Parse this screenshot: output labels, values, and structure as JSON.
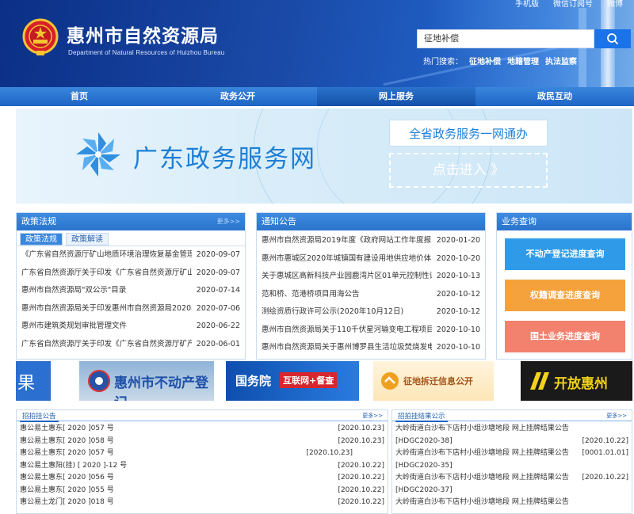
{
  "header": {
    "site_name": "惠州市自然资源局",
    "site_subtitle": "Department of Natural Resources of Huizhou Bureau",
    "top_links": [
      "手机版",
      "微信订阅号",
      "微博"
    ],
    "search": {
      "value": "征地补偿"
    },
    "hot_label": "热门搜索：",
    "hot_words": [
      "征地补偿",
      "地籍管理",
      "执法监察"
    ]
  },
  "nav": {
    "items": [
      "首页",
      "政务公开",
      "网上服务",
      "政民互动"
    ],
    "active_index": 2
  },
  "banner": {
    "title": "广东政务服务网",
    "box1": "全省政务服务一网通办",
    "box2": "点击进入 》"
  },
  "policy": {
    "title": "政策法规",
    "more": "更多>>",
    "tabs": [
      "政策法规",
      "政策解读"
    ],
    "items": [
      {
        "title": "《广东省自然资源厅矿山地质环境治理恢复基金管理暂",
        "date": "2020-09-07"
      },
      {
        "title": "广东省自然资源厅关于印发《广东省自然资源厅矿山地",
        "date": "2020-09-07"
      },
      {
        "title": "惠州市自然资源局\"双公示\"目录",
        "date": "2020-07-14"
      },
      {
        "title": "惠州市自然资源局关于印发惠州市自然资源局2020年",
        "date": "2020-07-06"
      },
      {
        "title": "惠州市建筑类规划审批管理文件",
        "date": "2020-06-22"
      },
      {
        "title": "广东省自然资源厅关于印发《广东省自然资源厅矿产资",
        "date": "2020-06-01"
      }
    ]
  },
  "notice": {
    "title": "通知公告",
    "items": [
      {
        "title": "惠州市自然资源局2019年度《政府网站工作年度报",
        "date": "2020-01-20"
      },
      {
        "title": "惠州市惠城区2020年城镇国有建设用地供应地价体系",
        "date": "2020-10-20"
      },
      {
        "title": "关于惠城区高新科技产业园鹿湾片区01单元控制性详细",
        "date": "2020-10-13"
      },
      {
        "title": "范和桥、范港桥项目用海公告",
        "date": "2020-10-12"
      },
      {
        "title": "测绘资质行政许可公示(2020年10月12日)",
        "date": "2020-10-12"
      },
      {
        "title": "惠州市自然资源局关于110千伏星河输变电工程项目用",
        "date": "2020-10-10"
      },
      {
        "title": "惠州市自然资源局关于惠州博罗县生活垃圾焚烧发电厂",
        "date": "2020-10-10"
      }
    ]
  },
  "business": {
    "title": "业务查询",
    "buttons": [
      {
        "label": "不动产登记进度查询",
        "color": "#2f9be8"
      },
      {
        "label": "权籍调查进度查询",
        "color": "#f5a23c"
      },
      {
        "label": "国土业务进度查询",
        "color": "#f2826e"
      }
    ]
  },
  "links": [
    {
      "text": "果"
    },
    {
      "text": "惠州市不动产登记"
    },
    {
      "text": "国务院",
      "text2": "互联网+督查"
    },
    {
      "text": "征地拆迁信息公开"
    },
    {
      "text": "开放惠州"
    }
  ],
  "bid_notice": {
    "tab": "招拍挂公告",
    "more": "更多>>",
    "items": [
      {
        "title": "惠公易土惠东[ 2020 ]057 号",
        "date": "[2020.10.23]"
      },
      {
        "title": "惠公易土惠东[ 2020 ]058 号",
        "date": "[2020.10.23]"
      },
      {
        "title": "惠公易土惠东[ 2020 ]057 号",
        "date": "[2020.10.23]"
      },
      {
        "title": "惠公易土惠阳(挂) [ 2020 ]-12 号",
        "date": "[2020.10.22]"
      },
      {
        "title": "惠公易土惠东[ 2020 ]056 号",
        "date": "[2020.10.22]"
      },
      {
        "title": "惠公易土惠东[ 2020 ]055 号",
        "date": "[2020.10.22]"
      },
      {
        "title": "惠公易土龙门[ 2020 ]018 号",
        "date": "[2020.10.22]"
      }
    ]
  },
  "bid_result": {
    "tab": "招拍挂结果公示",
    "more": "更多>>",
    "items": [
      {
        "title": "大岭街道白沙布下店村小组沙塘地段 网上挂牌结果公告",
        "date": ""
      },
      {
        "title": "[HDGC2020-38]",
        "date": "[2020.10.22]"
      },
      {
        "title": "大岭街道白沙布下店村小组沙塘地段 网上挂牌结果公告",
        "date": "[0001.01.01]"
      },
      {
        "title": "[HDGC2020-35]",
        "date": ""
      },
      {
        "title": "大岭街道白沙布下店村小组沙塘地段 网上挂牌结果公告",
        "date": "[2020.10.22]"
      },
      {
        "title": "[HDGC2020-37]",
        "date": ""
      },
      {
        "title": "大岭街道白沙布下店村小组沙塘地段 网上挂牌结果公告",
        "date": ""
      }
    ]
  }
}
